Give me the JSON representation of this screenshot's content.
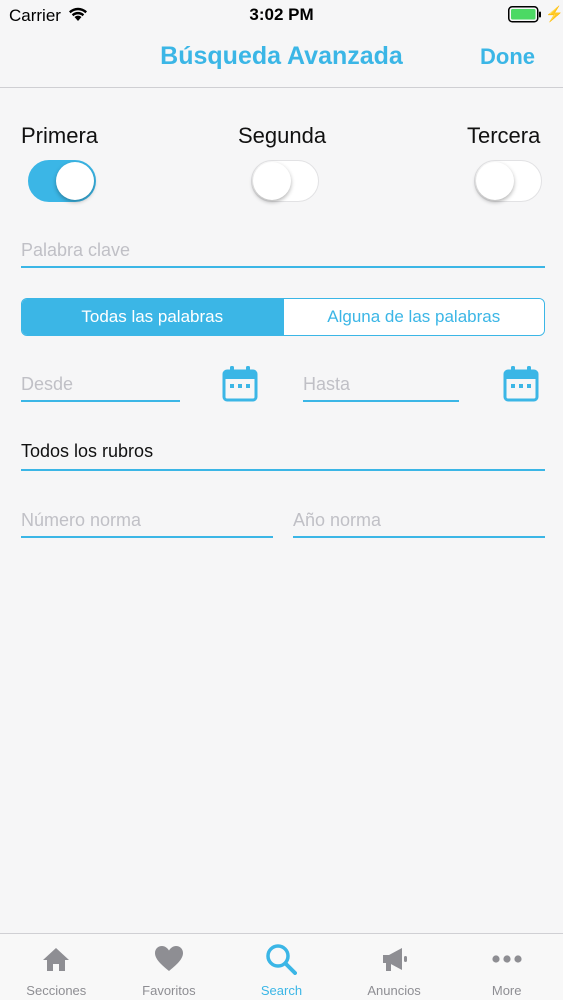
{
  "status_bar": {
    "carrier": "Carrier",
    "time": "3:02 PM"
  },
  "nav": {
    "title": "Búsqueda Avanzada",
    "done_label": "Done"
  },
  "toggles": [
    {
      "label": "Primera",
      "on": true
    },
    {
      "label": "Segunda",
      "on": false
    },
    {
      "label": "Tercera",
      "on": false
    }
  ],
  "keyword": {
    "placeholder": "Palabra clave",
    "value": ""
  },
  "segmented": {
    "options": [
      "Todas las palabras",
      "Alguna de las palabras"
    ],
    "selected": "Todas las palabras"
  },
  "dates": {
    "from_placeholder": "Desde",
    "to_placeholder": "Hasta",
    "icon": "calendar-icon"
  },
  "category": {
    "value": "Todos los rubros"
  },
  "norm": {
    "number_placeholder": "Número norma",
    "year_placeholder": "Año norma"
  },
  "tabs": [
    {
      "label": "Secciones",
      "icon": "home-icon",
      "active": false
    },
    {
      "label": "Favoritos",
      "icon": "heart-icon",
      "active": false
    },
    {
      "label": "Search",
      "icon": "search-icon",
      "active": true
    },
    {
      "label": "Anuncios",
      "icon": "megaphone-icon",
      "active": false
    },
    {
      "label": "More",
      "icon": "more-icon",
      "active": false
    }
  ],
  "colors": {
    "accent": "#3bb6e6",
    "background": "#f6f6f7",
    "tab_inactive": "#8e8e93"
  }
}
